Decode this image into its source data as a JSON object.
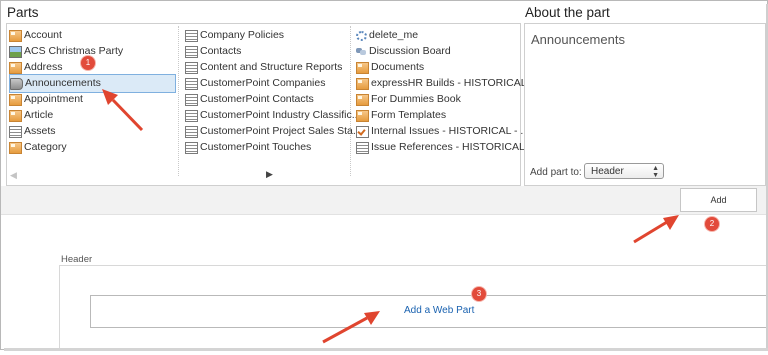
{
  "parts_title": "Parts",
  "about_title": "About the part",
  "columns": [
    [
      {
        "label": "Account",
        "icon": "app-icon"
      },
      {
        "label": "ACS Christmas Party",
        "icon": "picture-library-icon"
      },
      {
        "label": "Address",
        "icon": "app-icon"
      },
      {
        "label": "Announcements",
        "icon": "announcement-icon",
        "selected": true
      },
      {
        "label": "Appointment",
        "icon": "app-icon"
      },
      {
        "label": "Article",
        "icon": "app-icon"
      },
      {
        "label": "Assets",
        "icon": "list-icon"
      },
      {
        "label": "Category",
        "icon": "app-icon"
      }
    ],
    [
      {
        "label": "Company Policies",
        "icon": "list-icon"
      },
      {
        "label": "Contacts",
        "icon": "list-icon"
      },
      {
        "label": "Content and Structure Reports",
        "icon": "list-icon"
      },
      {
        "label": "CustomerPoint Companies",
        "icon": "list-icon"
      },
      {
        "label": "CustomerPoint Contacts",
        "icon": "list-icon"
      },
      {
        "label": "CustomerPoint Industry Classific...",
        "icon": "list-icon"
      },
      {
        "label": "CustomerPoint Project Sales Sta...",
        "icon": "list-icon"
      },
      {
        "label": "CustomerPoint Touches",
        "icon": "list-icon"
      }
    ],
    [
      {
        "label": "delete_me",
        "icon": "gear-icon"
      },
      {
        "label": "Discussion Board",
        "icon": "discussion-icon"
      },
      {
        "label": "Documents",
        "icon": "app-icon"
      },
      {
        "label": "expressHR Builds - HISTORICAL",
        "icon": "app-icon"
      },
      {
        "label": "For Dummies Book",
        "icon": "app-icon"
      },
      {
        "label": "Form Templates",
        "icon": "app-icon"
      },
      {
        "label": "Internal Issues - HISTORICAL - ...",
        "icon": "task-icon"
      },
      {
        "label": "Issue References - HISTORICAL ...",
        "icon": "list-icon"
      }
    ]
  ],
  "scroll": {
    "left_icon": "scroll-left-icon",
    "right_icon": "scroll-right-icon"
  },
  "about": {
    "part_name": "Announcements",
    "add_part_to_label": "Add part to:",
    "add_part_to_value": "Header"
  },
  "add_button_label": "Add",
  "header_zone_label": "Header",
  "add_web_part_label": "Add a Web Part",
  "callouts": [
    {
      "number": "1"
    },
    {
      "number": "2"
    },
    {
      "number": "3"
    }
  ],
  "colors": {
    "callout": "#e24b3b",
    "link": "#1a62b0",
    "selection": "#dbeaf7"
  }
}
